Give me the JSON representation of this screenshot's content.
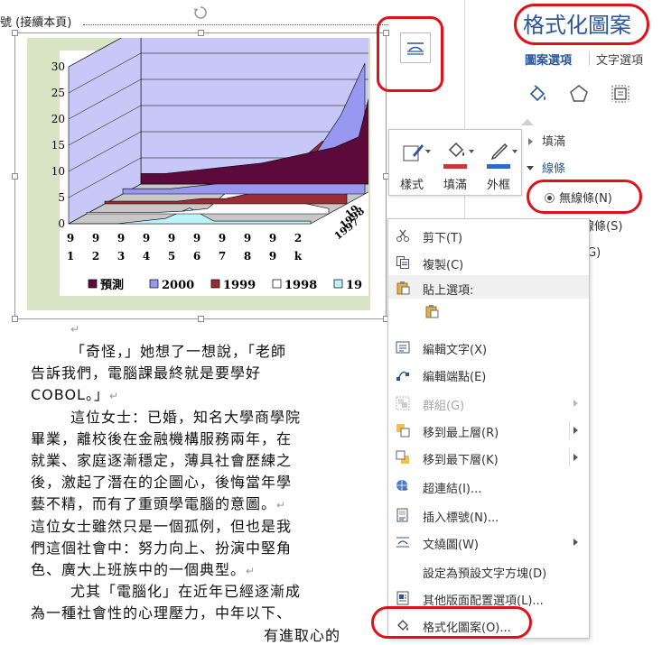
{
  "document": {
    "heading": "號 (接續本頁)",
    "paragraphs": [
      {
        "text": "「奇怪，」她想了一想說，「老師",
        "indent": true
      },
      {
        "text": "告訴我們，電腦課最終就是要學好"
      },
      {
        "text": "COBOL。」",
        "mark": "↵"
      },
      {
        "text": "這位女士：已婚，知名大學商學院",
        "indent": true
      },
      {
        "text": "畢業，離校後在金融機構服務兩年，在"
      },
      {
        "text": "就業、家庭逐漸穩定，薄具社會歷練之"
      },
      {
        "text": "後，激起了潛在的企圖心，後悔當年學"
      },
      {
        "text": "藝不精，而有了重頭學電腦的意圖。",
        "mark": "↵"
      },
      {
        "text": "這位女士雖然只是一個孤例，但也是我"
      },
      {
        "text": "們這個社會中：努力向上、扮演中堅角"
      },
      {
        "text": "色、廣大上班族中的一個典型。",
        "mark": "↵"
      },
      {
        "text": "尤其「電腦化」在近年已經逐漸成",
        "indent": true
      },
      {
        "text": "為一種社會性的心理壓力，中年以下、"
      },
      {
        "text": "有進取心的",
        "right": true
      }
    ],
    "para_mark_after_chart": "↵"
  },
  "chart_data": {
    "type": "bar",
    "subtype": "3d-area",
    "yticks": [
      "0",
      "5",
      "10",
      "15",
      "20",
      "25",
      "30"
    ],
    "ylim": [
      0,
      30
    ],
    "x_tick_top": [
      "9",
      "9",
      "9",
      "9",
      "9",
      "9",
      "9",
      "9",
      "9",
      "2",
      ""
    ],
    "x_tick_bottom": [
      "1",
      "2",
      "3",
      "4",
      "5",
      "6",
      "7",
      "8",
      "9",
      "k",
      ""
    ],
    "depth_labels": [
      "19",
      "1998",
      "1997"
    ],
    "series": [
      {
        "name": "預測",
        "color": "#5c0a3c",
        "values": [
          2,
          2,
          2.5,
          3,
          3.5,
          4,
          5,
          6,
          7,
          9,
          27
        ]
      },
      {
        "name": "2000",
        "color": "#9898f0",
        "values": [
          1,
          1,
          1,
          1.5,
          2,
          2.5,
          3,
          5,
          8,
          15,
          25
        ]
      },
      {
        "name": "1999",
        "color": "#9b2b34",
        "values": [
          0.5,
          0.5,
          0.5,
          0.5,
          1,
          1,
          2,
          4,
          8,
          12,
          10
        ]
      },
      {
        "name": "1998",
        "color": "#ffffff",
        "values": [
          0.3,
          0.3,
          0.3,
          0.3,
          0.5,
          1,
          5,
          6,
          3,
          2,
          1
        ]
      },
      {
        "name": "19",
        "color": "#b8f4f8",
        "values": [
          0,
          0,
          0,
          0.5,
          1,
          3,
          0.5,
          0.5,
          0.5,
          0.5,
          0.5
        ]
      }
    ],
    "colors": {
      "plot_wall": "#c8c8f8",
      "frame_bg": "#d9e4c4",
      "floor": "#c8c8c8"
    }
  },
  "format_pane": {
    "title": "格式化圖案",
    "tabs": [
      {
        "label": "圖案選項",
        "active": true
      },
      {
        "label": "文字選項"
      }
    ],
    "sections": {
      "fill": "填滿",
      "line": "線條"
    },
    "line_options": [
      {
        "label": "無線條(N)",
        "checked": true
      },
      {
        "label": "實心線條(S)"
      },
      {
        "label": "漸層線條(G)"
      }
    ],
    "visible_line_option_fragments": [
      "無線條(N)",
      "實心線條(S)",
      "線條(G)"
    ]
  },
  "mini_toolbar": {
    "buttons": [
      {
        "label": "樣式",
        "color": "#2b579a"
      },
      {
        "label": "填滿",
        "color": "#d13438"
      },
      {
        "label": "外框",
        "color": "#2b6cc4"
      }
    ]
  },
  "context_menu": {
    "items": [
      {
        "label": "剪下(T)",
        "icon": "scissors-icon"
      },
      {
        "label": "複製(C)",
        "icon": "copy-icon"
      },
      {
        "label": "貼上選項:",
        "icon": "paste-icon",
        "header": true
      },
      {
        "label": "",
        "icon": "paste-keep-icon",
        "paste_button": true
      },
      {
        "label": "編輯文字(X)",
        "icon": "edit-text-icon"
      },
      {
        "label": "編輯端點(E)",
        "icon": "edit-points-icon"
      },
      {
        "label": "群組(G)",
        "icon": "group-icon",
        "disabled": true,
        "submenu": true
      },
      {
        "label": "移到最上層(R)",
        "icon": "bring-front-icon",
        "submenu": true,
        "split": true
      },
      {
        "label": "移到最下層(K)",
        "icon": "send-back-icon",
        "submenu": true,
        "split": true
      },
      {
        "label": "超連結(I)...",
        "icon": "hyperlink-icon"
      },
      {
        "label": "插入標號(N)...",
        "icon": "insert-caption-icon"
      },
      {
        "label": "文繞圖(W)",
        "icon": "wrap-text-icon",
        "submenu": true
      },
      {
        "label": "設定為預設文字方塊(D)",
        "icon": ""
      },
      {
        "label": "其他版面配置選項(L)...",
        "icon": "layout-more-icon"
      },
      {
        "label": "格式化圖案(O)...",
        "icon": "format-shape-icon"
      }
    ]
  }
}
